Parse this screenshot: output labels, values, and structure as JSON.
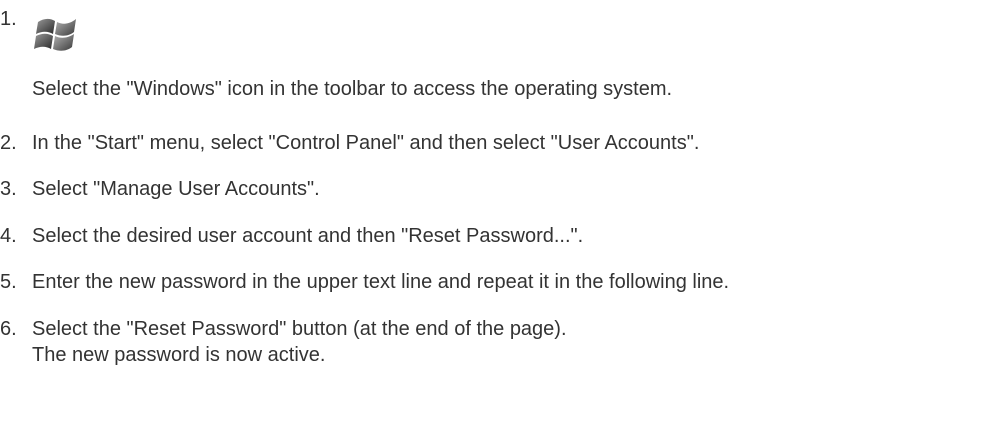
{
  "steps": [
    {
      "number": "1.",
      "icon": "windows-logo-icon",
      "text": "Select the \"Windows\" icon in the toolbar to access the operating system."
    },
    {
      "number": "2.",
      "text": "In the \"Start\" menu, select \"Control Panel\" and then select \"User Accounts\"."
    },
    {
      "number": "3.",
      "text": "Select \"Manage User Accounts\"."
    },
    {
      "number": "4.",
      "text": "Select the desired user account and then \"Reset Password...\"."
    },
    {
      "number": "5.",
      "text": "Enter the new password in the upper text line and repeat it in the following line."
    },
    {
      "number": "6.",
      "text": "Select the \"Reset Password\" button (at the end of the page).",
      "continuation": "The new password is now active."
    }
  ]
}
